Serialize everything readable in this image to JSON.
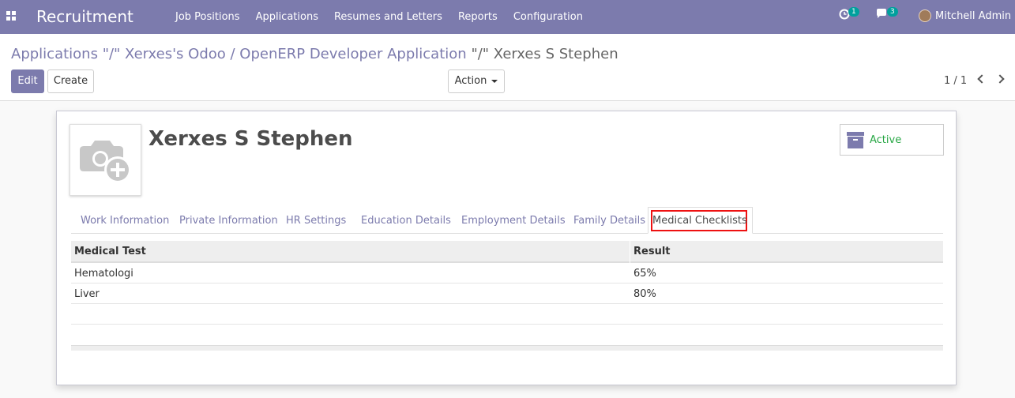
{
  "navbar": {
    "app_name": "Recruitment",
    "menu": [
      "Job Positions",
      "Applications",
      "Resumes and Letters",
      "Reports",
      "Configuration"
    ],
    "activity_count": "1",
    "messages_count": "3",
    "user_name": "Mitchell Admin",
    "color": "#7c7bad"
  },
  "breadcrumb": {
    "part1": "Applications",
    "sep1": "\"/\"",
    "part2": "Xerxes's Odoo / OpenERP Developer Application",
    "sep2": "\"/\"",
    "current": "Xerxes S Stephen"
  },
  "buttons": {
    "edit": "Edit",
    "create": "Create",
    "action": "Action"
  },
  "pager": {
    "value": "1 / 1"
  },
  "employee": {
    "name": "Xerxes S Stephen",
    "status": "Active"
  },
  "tabs": [
    "Work Information",
    "Private Information",
    "HR Settings",
    "Education Details",
    "Employment Details",
    "Family Details",
    "Medical Checklists"
  ],
  "medical_table": {
    "headers": [
      "Medical Test",
      "Result"
    ],
    "rows": [
      [
        "Hematologi",
        "65%"
      ],
      [
        "Liver",
        "80%"
      ]
    ]
  },
  "icons": [
    "apps-grid-icon",
    "activity-clock-icon",
    "chat-icon",
    "archive-box-icon",
    "camera-add-icon",
    "chevron-left-icon",
    "chevron-right-icon"
  ]
}
